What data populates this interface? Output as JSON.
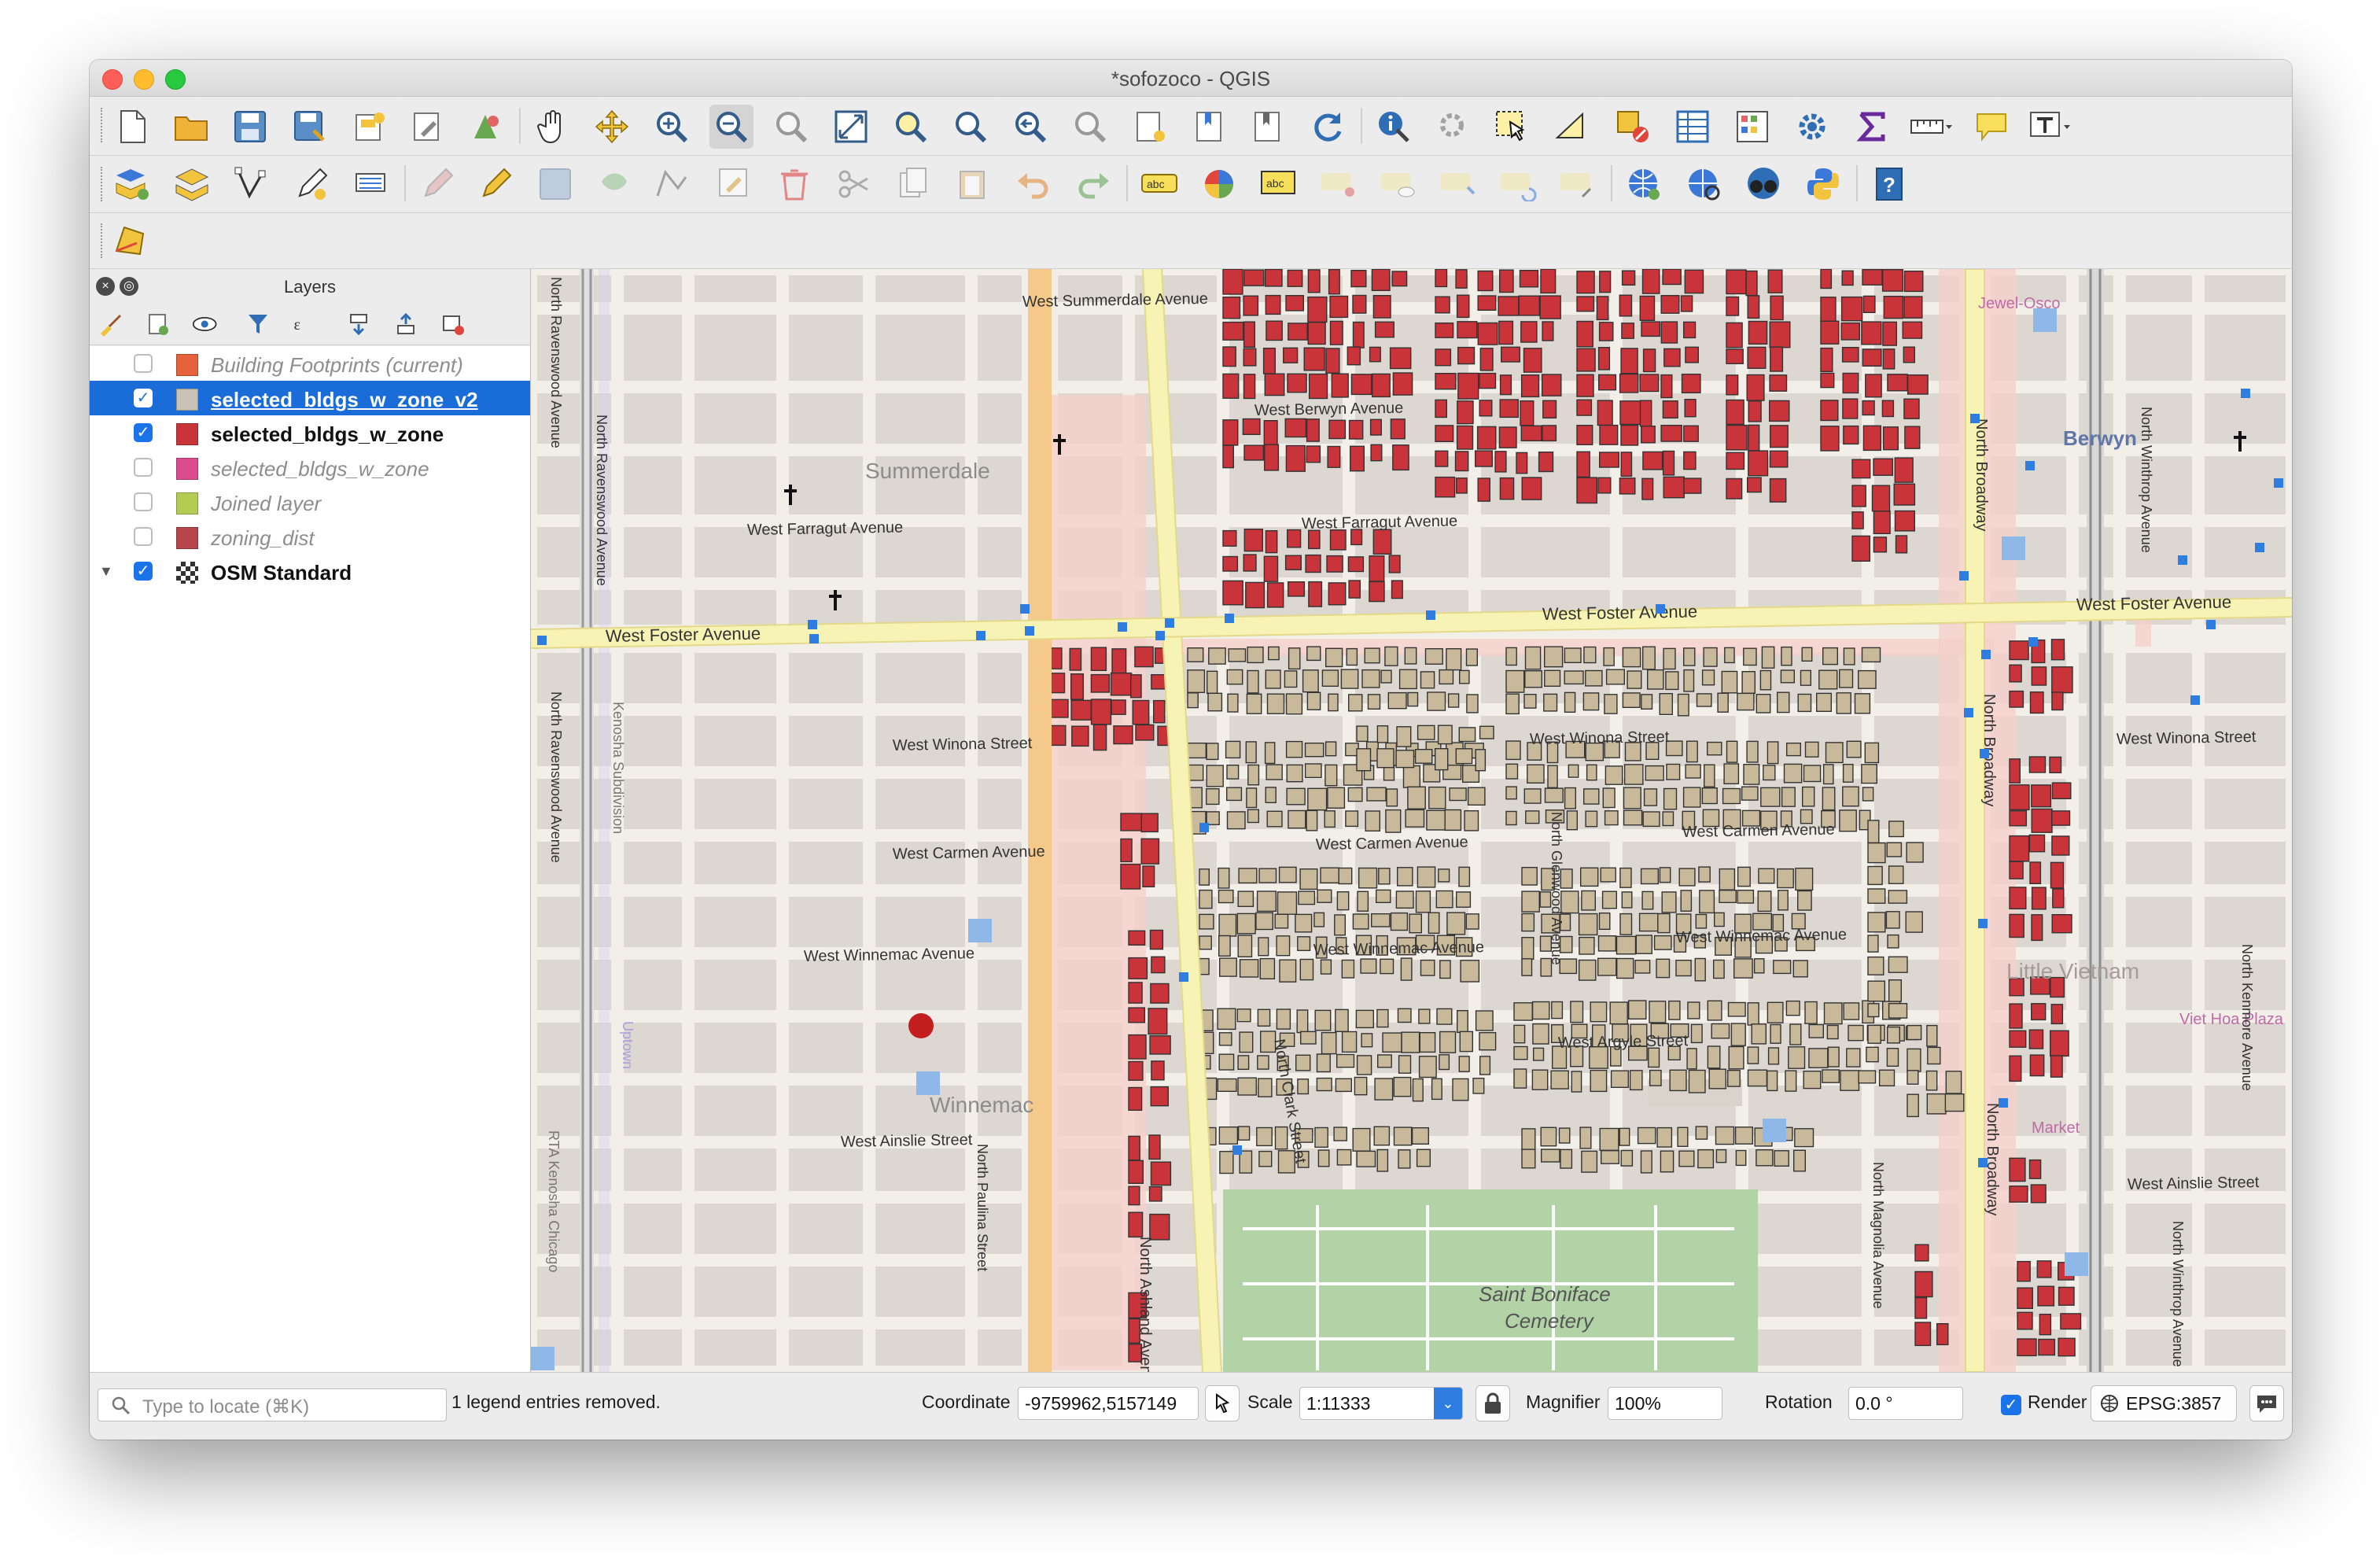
{
  "window": {
    "title": "*sofozoco - QGIS"
  },
  "toolbar1": [
    "new-project",
    "open-project",
    "save-project",
    "save-as",
    "new-print-layout",
    "layout-manager",
    "style-manager",
    "pan",
    "pan-to-selection",
    "zoom-in",
    "zoom-out",
    "zoom-native",
    "zoom-full",
    "zoom-to-selection",
    "zoom-to-layer",
    "zoom-last",
    "zoom-next",
    "new-bookmark",
    "show-bookmarks",
    "show-spatial-bookmarks",
    "refresh",
    "identify",
    "map-tips",
    "select-features",
    "select-by-polygon",
    "deselect",
    "attribute-table",
    "statistics",
    "settings",
    "field-calculator",
    "measure",
    "annotations",
    "text-annotation"
  ],
  "toolbar2": [
    "add-vector",
    "add-raster",
    "digitize",
    "current-edits",
    "toggle-editing",
    "save-edits",
    "add-feature",
    "vertex-tool",
    "delete-selected",
    "cut-features",
    "copy-features",
    "paste-features",
    "undo",
    "redo",
    "label-tool",
    "diagram-tool",
    "label-highlight",
    "pin-labels",
    "show-hide-labels",
    "move-label",
    "rotate-label",
    "change-label",
    "browser",
    "metasearch",
    "search-osm",
    "python-console",
    "help"
  ],
  "layers_panel": {
    "title": "Layers",
    "items": [
      {
        "label": "Building Footprints (current)",
        "checked": false,
        "color": "#e5623c",
        "state": "off"
      },
      {
        "label": "selected_bldgs_w_zone_v2",
        "checked": true,
        "color": "#c9c1b3",
        "state": "selected"
      },
      {
        "label": "selected_bldgs_w_zone",
        "checked": true,
        "color": "#c9333a",
        "state": "on"
      },
      {
        "label": "selected_bldgs_w_zone",
        "checked": false,
        "color": "#db4c8c",
        "state": "off"
      },
      {
        "label": "Joined layer",
        "checked": false,
        "color": "#b4cc54",
        "state": "off"
      },
      {
        "label": "zoning_dist",
        "checked": false,
        "color": "#b8454b",
        "state": "off"
      },
      {
        "label": "OSM Standard",
        "checked": true,
        "color": "",
        "state": "on"
      }
    ]
  },
  "map": {
    "colors": {
      "background": "#f2efe9",
      "block": "#dcd7d0",
      "building_red": "#c9333a",
      "building_tan": "#c8b99a",
      "major_road": "#f5d59b",
      "secondary_road": "#f7f3b4",
      "park": "#b2d3a6"
    },
    "labels": {
      "summerdale_ave": "West Summerdale Avenue",
      "berwyn_ave": "West Berwyn Avenue",
      "farragut_ave_1": "West Farragut Avenue",
      "farragut_ave_2": "West Farragut Avenue",
      "foster_ave_1": "West Foster Avenue",
      "foster_ave_2": "West Foster Avenue",
      "foster_ave_3": "West Foster Avenue",
      "winona_st_1": "West Winona Street",
      "winona_st_2": "West Winona Street",
      "winona_st_3": "West Winona Street",
      "carmen_ave_1": "West Carmen Avenue",
      "carmen_ave_2": "West Carmen Avenue",
      "carmen_ave_3": "West Carmen Avenue",
      "winnemac_ave_1": "West Winnemac Avenue",
      "winnemac_ave_2": "West Winnemac Avenue",
      "winnemac_ave_3": "West Winnemac Avenue",
      "argyle_st": "West Argyle Street",
      "ainslie_st_1": "West Ainslie Street",
      "ainslie_st_2": "West Ainslie Street",
      "summerdale": "Summerdale",
      "winnemac": "Winnemac",
      "berwyn": "Berwyn",
      "little_vietnam": "Little Vietnam",
      "jewel_osco": "Jewel-Osco",
      "viet_hoa_plaza": "Viet Hoa Plaza",
      "market": "Market",
      "saint_boniface": "Saint Boniface",
      "cemetery": "Cemetery",
      "ashland": "North Ashland Avenue",
      "clark": "North Clark Street",
      "broadway_1": "North Broadway",
      "broadway_2": "North Broadway",
      "broadway_3": "North Broadway",
      "glenwood": "North Glenwood Avenue",
      "magnolia": "North Magnolia Avenue",
      "winthrop_1": "North Winthrop Avenue",
      "winthrop_2": "North Winthrop Avenue",
      "kenmore": "North Kenmore Avenue",
      "ravenswood_1": "North Ravenswood Avenue",
      "ravenswood_2": "North Ravenswood Avenue",
      "ravenswood_3": "North Ravenswood Avenue",
      "paulina": "North Paulina Street",
      "kenosha_sub": "Kenosha Subdivision",
      "rta_kenosha": "RTA Kenosha Chicago",
      "uptown": "Uptown"
    }
  },
  "status_bar": {
    "locate_placeholder": "Type to locate (⌘K)",
    "message": "1 legend entries removed.",
    "coordinate_label": "Coordinate",
    "coordinate_value": "-9759962,5157149",
    "scale_label": "Scale",
    "scale_value": "1:11333",
    "magnifier_label": "Magnifier",
    "magnifier_value": "100%",
    "rotation_label": "Rotation",
    "rotation_value": "0.0 °",
    "render_label": "Render",
    "render_checked": true,
    "crs": "EPSG:3857"
  }
}
